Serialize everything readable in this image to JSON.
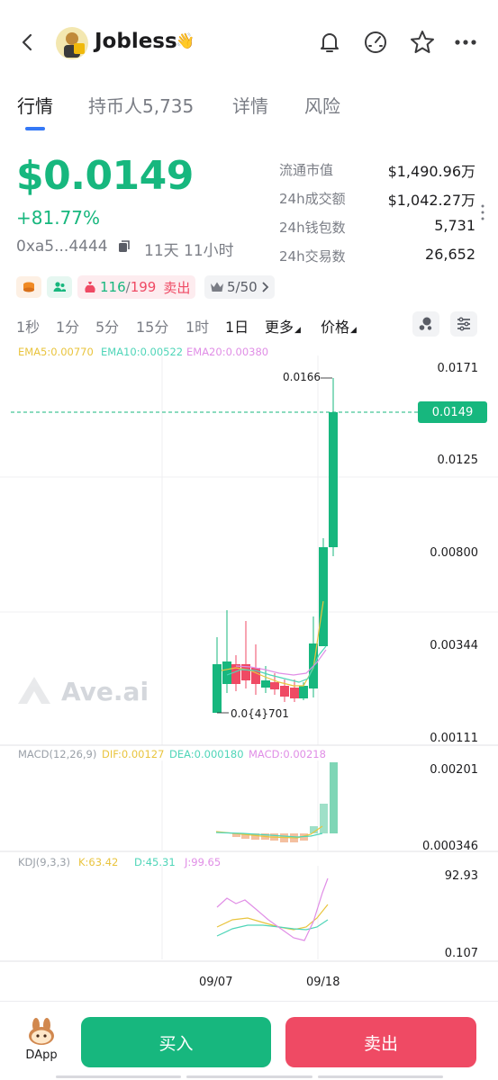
{
  "header": {
    "token_name": "Jobless",
    "hand_emoji": "👋",
    "back_icon": "chevron-left-icon",
    "actions": [
      "bell-icon",
      "gauge-icon",
      "star-icon",
      "more-icon"
    ]
  },
  "tabs": [
    {
      "label": "行情",
      "active": true
    },
    {
      "label": "持币人5,735",
      "active": false
    },
    {
      "label": "详情",
      "active": false
    },
    {
      "label": "风险",
      "active": false
    }
  ],
  "price": {
    "value": "$0.0149",
    "change": "+81.77%",
    "address": "0xa5...4444",
    "age": "11天 11小时"
  },
  "stats": [
    {
      "label": "流通市值",
      "value": "$1,490.96万"
    },
    {
      "label": "24h成交额",
      "value": "$1,042.27万"
    },
    {
      "label": "24h钱包数",
      "value": "5,731"
    },
    {
      "label": "24h交易数",
      "value": "26,652"
    }
  ],
  "tags": {
    "holders_buy": "116",
    "holders_sep": "/",
    "holders_total": "199",
    "sell_label": "卖出",
    "rank": "5/50"
  },
  "timeframes": [
    "1秒",
    "1分",
    "5分",
    "15分",
    "1时",
    "1日"
  ],
  "active_timeframe": "1日",
  "more_label": "更多",
  "price_label": "价格",
  "ema": {
    "ema5": "EMA5:0.00770",
    "ema10": "EMA10:0.00522",
    "ema20": "EMA20:0.00380"
  },
  "price_axis": [
    "0.0171",
    "0.0149",
    "0.0125",
    "0.00800",
    "0.00344",
    "0.00111"
  ],
  "annotations": {
    "high": "0.0166",
    "low": "0.0{4}701"
  },
  "watermark": "Ave.ai",
  "macd": {
    "title": "MACD(12,26,9)",
    "dif": "DIF:0.00127",
    "dea": "DEA:0.000180",
    "macd": "MACD:0.00218",
    "axis_top": "0.00201",
    "axis_bottom": "0.000346"
  },
  "kdj": {
    "title": "KDJ(9,3,3)",
    "k": "K:63.42",
    "d": "D:45.31",
    "j": "J:99.65",
    "axis_top": "92.93",
    "axis_bottom": "0.107"
  },
  "x_axis": [
    "09/07",
    "09/18"
  ],
  "bottom": {
    "dapp_label": "DApp",
    "buy_label": "买入",
    "sell_label": "卖出"
  },
  "colors": {
    "green": "#17b77e",
    "red": "#ef4a64",
    "accent": "#3478f6",
    "ema5": "#e9c43e",
    "ema10": "#4fd5b8",
    "ema20": "#e08ee6"
  }
}
